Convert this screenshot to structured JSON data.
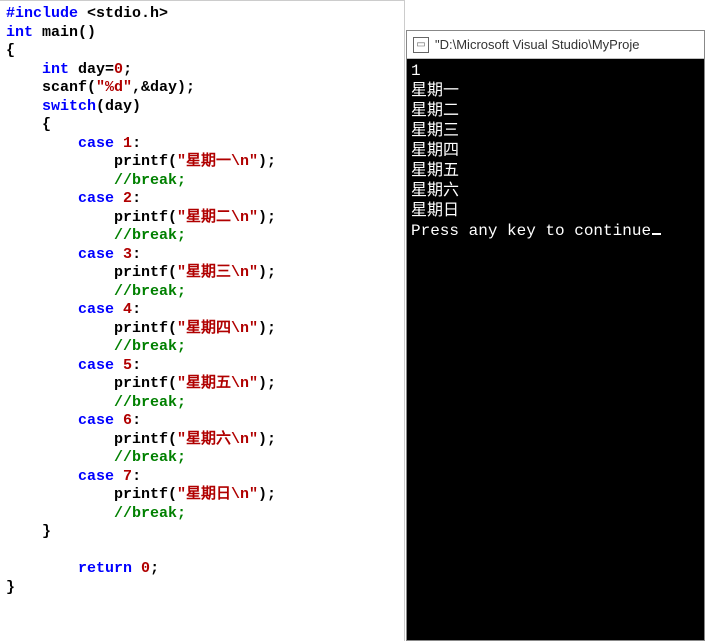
{
  "editor": {
    "lines": [
      [
        {
          "t": "#include",
          "c": "tok-inc"
        },
        {
          "t": " ",
          "c": ""
        },
        {
          "t": "<stdio.h>",
          "c": "tok-ang"
        }
      ],
      [
        {
          "t": "int",
          "c": "tok-kw"
        },
        {
          "t": " main()",
          "c": "tok-id"
        }
      ],
      [
        {
          "t": "{",
          "c": "tok-op"
        }
      ],
      [
        {
          "t": "    ",
          "c": ""
        },
        {
          "t": "int",
          "c": "tok-kw"
        },
        {
          "t": " day=",
          "c": "tok-id"
        },
        {
          "t": "0",
          "c": "tok-num"
        },
        {
          "t": ";",
          "c": "tok-op"
        }
      ],
      [
        {
          "t": "    scanf(",
          "c": "tok-id"
        },
        {
          "t": "\"%d\"",
          "c": "tok-str"
        },
        {
          "t": ",&day);",
          "c": "tok-id"
        }
      ],
      [
        {
          "t": "    ",
          "c": ""
        },
        {
          "t": "switch",
          "c": "tok-kw"
        },
        {
          "t": "(day)",
          "c": "tok-id"
        }
      ],
      [
        {
          "t": "    {",
          "c": "tok-op"
        }
      ],
      [
        {
          "t": "        ",
          "c": ""
        },
        {
          "t": "case",
          "c": "tok-kw"
        },
        {
          "t": " ",
          "c": ""
        },
        {
          "t": "1",
          "c": "tok-num"
        },
        {
          "t": ":",
          "c": "tok-op"
        }
      ],
      [
        {
          "t": "            printf(",
          "c": "tok-id"
        },
        {
          "t": "\"星期一\\n\"",
          "c": "tok-str"
        },
        {
          "t": ");",
          "c": "tok-id"
        }
      ],
      [
        {
          "t": "            ",
          "c": ""
        },
        {
          "t": "//break;",
          "c": "tok-cmt"
        }
      ],
      [
        {
          "t": "        ",
          "c": ""
        },
        {
          "t": "case",
          "c": "tok-kw"
        },
        {
          "t": " ",
          "c": ""
        },
        {
          "t": "2",
          "c": "tok-num"
        },
        {
          "t": ":",
          "c": "tok-op"
        }
      ],
      [
        {
          "t": "            printf(",
          "c": "tok-id"
        },
        {
          "t": "\"星期二\\n\"",
          "c": "tok-str"
        },
        {
          "t": ");",
          "c": "tok-id"
        }
      ],
      [
        {
          "t": "            ",
          "c": ""
        },
        {
          "t": "//break;",
          "c": "tok-cmt"
        }
      ],
      [
        {
          "t": "        ",
          "c": ""
        },
        {
          "t": "case",
          "c": "tok-kw"
        },
        {
          "t": " ",
          "c": ""
        },
        {
          "t": "3",
          "c": "tok-num"
        },
        {
          "t": ":",
          "c": "tok-op"
        }
      ],
      [
        {
          "t": "            printf(",
          "c": "tok-id"
        },
        {
          "t": "\"星期三\\n\"",
          "c": "tok-str"
        },
        {
          "t": ");",
          "c": "tok-id"
        }
      ],
      [
        {
          "t": "            ",
          "c": ""
        },
        {
          "t": "//break;",
          "c": "tok-cmt"
        }
      ],
      [
        {
          "t": "        ",
          "c": ""
        },
        {
          "t": "case",
          "c": "tok-kw"
        },
        {
          "t": " ",
          "c": ""
        },
        {
          "t": "4",
          "c": "tok-num"
        },
        {
          "t": ":",
          "c": "tok-op"
        }
      ],
      [
        {
          "t": "            printf(",
          "c": "tok-id"
        },
        {
          "t": "\"星期四\\n\"",
          "c": "tok-str"
        },
        {
          "t": ");",
          "c": "tok-id"
        }
      ],
      [
        {
          "t": "            ",
          "c": ""
        },
        {
          "t": "//break;",
          "c": "tok-cmt"
        }
      ],
      [
        {
          "t": "        ",
          "c": ""
        },
        {
          "t": "case",
          "c": "tok-kw"
        },
        {
          "t": " ",
          "c": ""
        },
        {
          "t": "5",
          "c": "tok-num"
        },
        {
          "t": ":",
          "c": "tok-op"
        }
      ],
      [
        {
          "t": "            printf(",
          "c": "tok-id"
        },
        {
          "t": "\"星期五\\n\"",
          "c": "tok-str"
        },
        {
          "t": ");",
          "c": "tok-id"
        }
      ],
      [
        {
          "t": "            ",
          "c": ""
        },
        {
          "t": "//break;",
          "c": "tok-cmt"
        }
      ],
      [
        {
          "t": "        ",
          "c": ""
        },
        {
          "t": "case",
          "c": "tok-kw"
        },
        {
          "t": " ",
          "c": ""
        },
        {
          "t": "6",
          "c": "tok-num"
        },
        {
          "t": ":",
          "c": "tok-op"
        }
      ],
      [
        {
          "t": "            printf(",
          "c": "tok-id"
        },
        {
          "t": "\"星期六\\n\"",
          "c": "tok-str"
        },
        {
          "t": ");",
          "c": "tok-id"
        }
      ],
      [
        {
          "t": "            ",
          "c": ""
        },
        {
          "t": "//break;",
          "c": "tok-cmt"
        }
      ],
      [
        {
          "t": "        ",
          "c": ""
        },
        {
          "t": "case",
          "c": "tok-kw"
        },
        {
          "t": " ",
          "c": ""
        },
        {
          "t": "7",
          "c": "tok-num"
        },
        {
          "t": ":",
          "c": "tok-op"
        }
      ],
      [
        {
          "t": "            printf(",
          "c": "tok-id"
        },
        {
          "t": "\"星期日\\n\"",
          "c": "tok-str"
        },
        {
          "t": ");",
          "c": "tok-id"
        }
      ],
      [
        {
          "t": "            ",
          "c": ""
        },
        {
          "t": "//break;",
          "c": "tok-cmt"
        }
      ],
      [
        {
          "t": "    }",
          "c": "tok-op"
        }
      ],
      [
        {
          "t": "",
          "c": ""
        }
      ],
      [
        {
          "t": "        ",
          "c": ""
        },
        {
          "t": "return",
          "c": "tok-kw"
        },
        {
          "t": " ",
          "c": ""
        },
        {
          "t": "0",
          "c": "tok-num"
        },
        {
          "t": ";",
          "c": "tok-op"
        }
      ],
      [
        {
          "t": "}",
          "c": "tok-op"
        }
      ]
    ]
  },
  "console": {
    "title": "\"D:\\Microsoft Visual Studio\\MyProje",
    "output_lines": [
      "1",
      "星期一",
      "星期二",
      "星期三",
      "星期四",
      "星期五",
      "星期六",
      "星期日",
      "Press any key to continue"
    ]
  }
}
